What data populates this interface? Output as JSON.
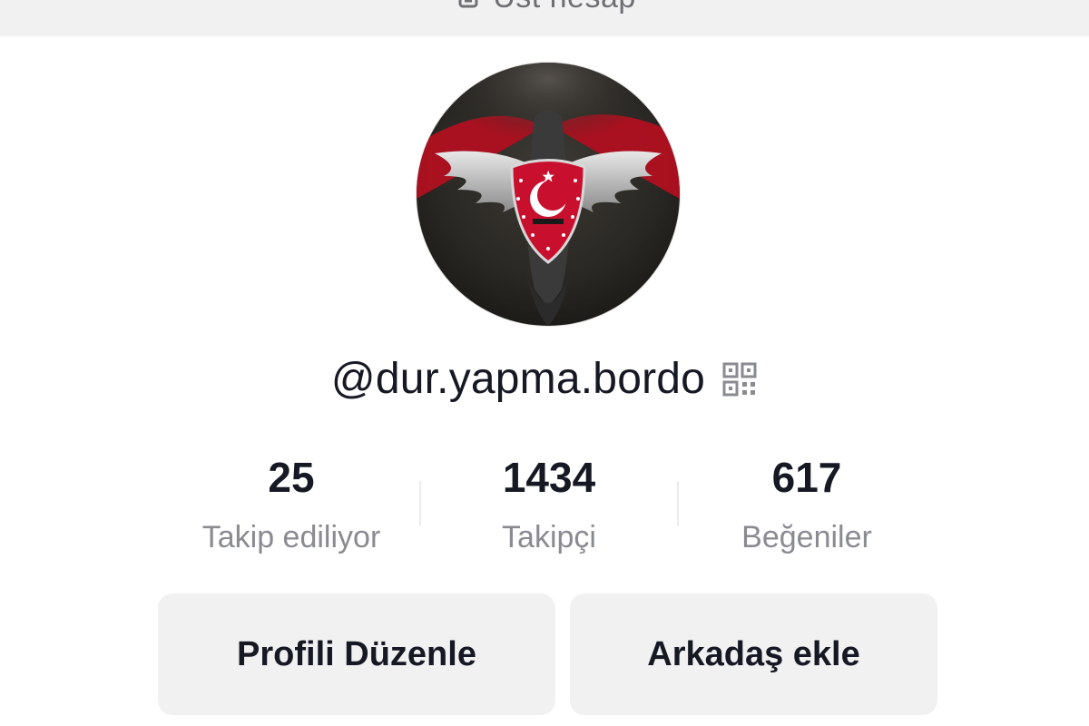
{
  "header": {
    "partial_title": "Üst hesap",
    "icon": "person-plus-icon"
  },
  "profile": {
    "avatar_description": "profile-avatar",
    "username": "@dur.yapma.bordo",
    "qr_icon": "qr-code-icon"
  },
  "stats": [
    {
      "value": "25",
      "label": "Takip ediliyor"
    },
    {
      "value": "1434",
      "label": "Takipçi"
    },
    {
      "value": "617",
      "label": "Beğeniler"
    }
  ],
  "actions": {
    "edit_profile": "Profili Düzenle",
    "add_friend": "Arkadaş ekle"
  },
  "colors": {
    "background": "#ffffff",
    "button_bg": "#f1f1f2",
    "text_primary": "#161823",
    "text_secondary": "#8a8b91",
    "accent_red": "#c8102e"
  }
}
